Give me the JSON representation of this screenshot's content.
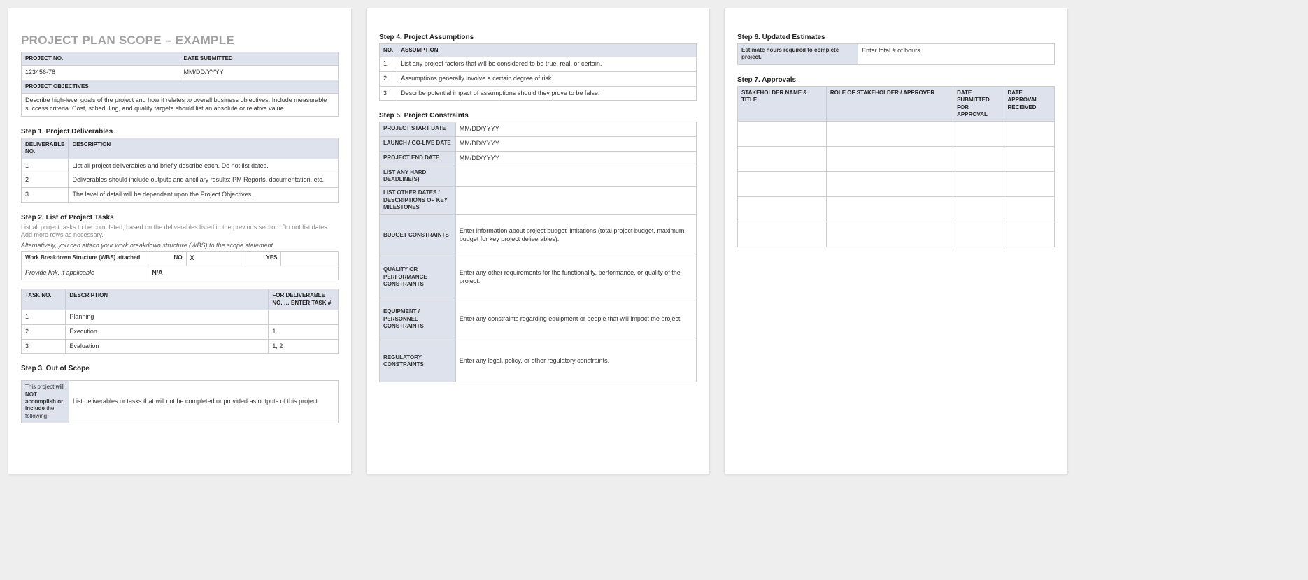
{
  "title": "PROJECT PLAN SCOPE – EXAMPLE",
  "info": {
    "projectNoHdr": "PROJECT NO.",
    "projectNoVal": "123456-78",
    "dateHdr": "DATE SUBMITTED",
    "dateVal": "MM/DD/YYYY",
    "objectivesHdr": "PROJECT OBJECTIVES",
    "objectivesVal": "Describe high-level goals of the project and how it relates to overall business objectives.  Include measurable success criteria.  Cost, scheduling, and quality targets should list an absolute or relative value."
  },
  "step1": {
    "heading": "Step 1. Project Deliverables",
    "colNo": "DELIVERABLE NO.",
    "colDesc": "DESCRIPTION",
    "r1n": "1",
    "r1d": "List all project deliverables and briefly describe each. Do not list dates.",
    "r2n": "2",
    "r2d": "Deliverables should include outputs and ancillary results: PM Reports, documentation, etc.",
    "r3n": "3",
    "r3d": "The level of detail will be dependent upon the Project Objectives."
  },
  "step2": {
    "heading": "Step 2. List of Project Tasks",
    "note": "List all project tasks to be completed, based on the deliverables listed in the previous section. Do not list dates. Add more rows as necessary.",
    "noteItalic": "Alternatively, you can attach your work breakdown structure (WBS) to the scope statement.",
    "wbsAttached": "Work Breakdown Structure (WBS) attached",
    "noLabel": "NO",
    "noVal": "X",
    "yesLabel": "YES",
    "yesVal": "",
    "linkLabel": "Provide link, if applicable",
    "linkVal": "N/A",
    "colTask": "TASK NO.",
    "colDesc": "DESCRIPTION",
    "colFor": "FOR DELIVERABLE NO. … ENTER TASK #",
    "r1n": "1",
    "r1d": "Planning",
    "r1f": "",
    "r2n": "2",
    "r2d": "Execution",
    "r2f": "1",
    "r3n": "3",
    "r3d": "Evaluation",
    "r3f": "1, 2"
  },
  "step3": {
    "heading": "Step 3. Out of Scope",
    "labelPre": "This project ",
    "labelBold": "will NOT accomplish or include",
    "labelPost": " the following:",
    "value": "List deliverables or tasks that will not be completed or provided as outputs of this project."
  },
  "step4": {
    "heading": "Step 4. Project Assumptions",
    "colNo": "NO.",
    "colAss": "ASSUMPTION",
    "r1n": "1",
    "r1d": "List any project factors that will be considered to be true, real, or certain.",
    "r2n": "2",
    "r2d": "Assumptions generally involve a certain degree of risk.",
    "r3n": "3",
    "r3d": "Describe potential impact of assumptions should they prove to be false."
  },
  "step5": {
    "heading": "Step 5. Project Constraints",
    "startHdr": "PROJECT START DATE",
    "startVal": "MM/DD/YYYY",
    "launchHdr": "LAUNCH / GO-LIVE DATE",
    "launchVal": "MM/DD/YYYY",
    "endHdr": "PROJECT END DATE",
    "endVal": "MM/DD/YYYY",
    "hardHdr": "LIST ANY HARD DEADLINE(S)",
    "hardVal": "",
    "otherHdr": "LIST OTHER DATES / DESCRIPTIONS OF KEY MILESTONES",
    "otherVal": "",
    "budgetHdr": "BUDGET CONSTRAINTS",
    "budgetVal": "Enter information about project budget limitations (total project budget, maximum budget for key project deliverables).",
    "qualityHdr": "QUALITY OR PERFORMANCE CONSTRAINTS",
    "qualityVal": "Enter any other requirements for the functionality, performance, or quality of the project.",
    "equipHdr": "EQUIPMENT / PERSONNEL CONSTRAINTS",
    "equipVal": "Enter any constraints regarding equipment or people that will impact the project.",
    "regHdr": "REGULATORY CONSTRAINTS",
    "regVal": "Enter any legal, policy, or other regulatory constraints."
  },
  "step6": {
    "heading": "Step 6. Updated Estimates",
    "label": "Estimate hours required to complete project.",
    "value": "Enter total # of hours"
  },
  "step7": {
    "heading": "Step 7. Approvals",
    "col1": "STAKEHOLDER NAME & TITLE",
    "col2": "ROLE OF STAKEHOLDER / APPROVER",
    "col3": "DATE SUBMITTED FOR APPROVAL",
    "col4": "DATE APPROVAL RECEIVED"
  }
}
